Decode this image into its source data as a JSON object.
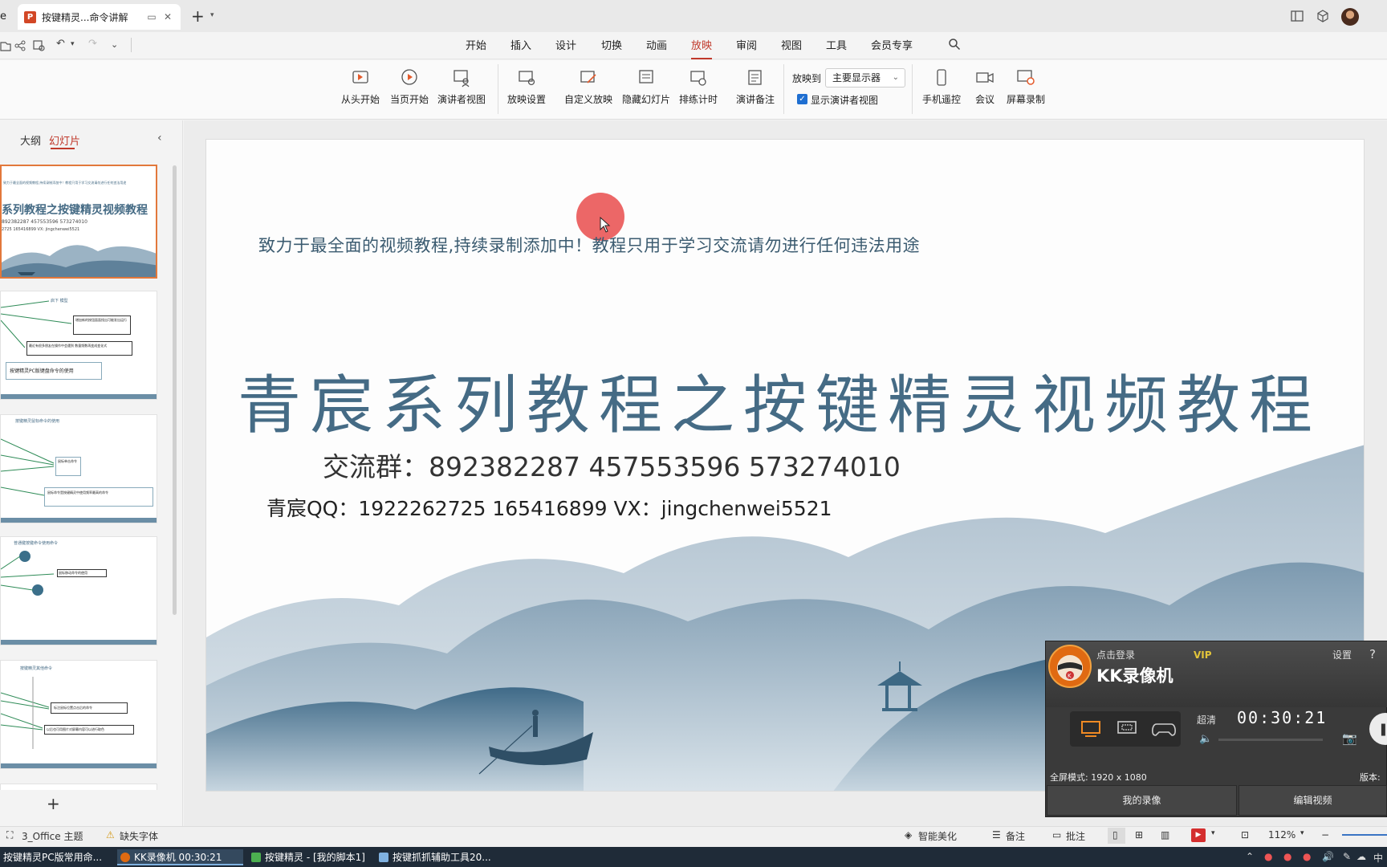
{
  "titlebar": {
    "left_tab_fragment": "e",
    "doc_tab": {
      "icon_text": "P",
      "title": "按键精灵...命令讲解"
    }
  },
  "menu": {
    "items": [
      "开始",
      "插入",
      "设计",
      "切换",
      "动画",
      "放映",
      "审阅",
      "视图",
      "工具",
      "会员专享"
    ],
    "active": "放映"
  },
  "ribbon": {
    "buttons": [
      "从头开始",
      "当页开始",
      "演讲者视图",
      "放映设置",
      "自定义放映",
      "隐藏幻灯片",
      "排练计时",
      "演讲备注",
      "手机遥控",
      "会议",
      "屏幕录制"
    ],
    "play_to_label": "放映到",
    "play_to_value": "主要显示器",
    "show_presenter_label": "显示演讲者视图"
  },
  "left_panel": {
    "tab_outline": "大纲",
    "tab_slides": "幻灯片",
    "thumb1": {
      "header": "致力于最全面的视频教程,持续录制添加中！教程只用于学习交流请勿进行任何违法用途",
      "title": "系列教程之按键精灵视频教程",
      "line": "892382287   457553596   573274010",
      "qq": "2725 165416899 VX: jingchenwei5521"
    },
    "thumb2": {
      "a": "启下 模型",
      "b": "增加新的按钮面面找出可能发出运行",
      "c": "最近有很多朋友在操作中会遇到 数量频数再变成变化式",
      "d": "按键精灵PC版键盘命令的使用"
    },
    "thumb3": {
      "a": "按键精灵鼠标命令的使用",
      "b": "鼠标单击命令",
      "c": "鼠标命令是按键精灵中使用频率最高的命令"
    },
    "thumb4": {
      "a": "普通键按键命令使用命令",
      "b": "鼠标移动命令的使用"
    },
    "thumb5": {
      "a": "按键精灵其他命令",
      "b": "标注鼠标位置点击后的命令",
      "c": "以后也可用图片对屏幕内容可以进行取色"
    }
  },
  "slide": {
    "subtitle": "致力于最全面的视频教程,持续录制添加中！教程只用于学习交流请勿进行任何违法用途",
    "title": "青宸系列教程之按键精灵视频教程",
    "groups": "交流群：892382287    457553596    573274010",
    "qq": "青宸QQ：1922262725  165416899  VX：jingchenwei5521"
  },
  "kk": {
    "login": "点击登录",
    "vip": "VIP",
    "settings": "设置",
    "help": "?",
    "name": "KK录像机",
    "quality": "超清",
    "time": "00:30:21",
    "status": "全屏模式: 1920 x 1080",
    "version": "版本:",
    "btn_my": "我的录像",
    "btn_edit": "编辑视频"
  },
  "statusbar": {
    "theme": "3_Office 主题",
    "missing_font": "缺失字体",
    "beautify": "智能美化",
    "notes": "备注",
    "comments": "批注",
    "zoom": "112%"
  },
  "taskbar": {
    "items": [
      "按键精灵PC版常用命...",
      "KK录像机 00:30:21",
      "按键精灵 - [我的脚本1]",
      "按键抓抓辅助工具20..."
    ],
    "ime": "中"
  },
  "colors": {
    "accent": "#c0392b",
    "slide_title": "#456b85",
    "kk_bg": "#3a3a3a",
    "taskbar": "#1f2b38"
  }
}
